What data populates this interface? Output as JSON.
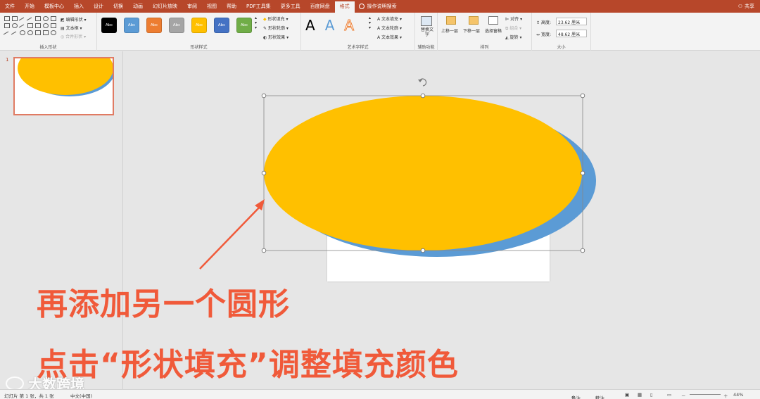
{
  "tabs": [
    "文件",
    "开始",
    "模板中心",
    "插入",
    "设计",
    "切换",
    "动画",
    "幻灯片放映",
    "审阅",
    "视图",
    "帮助",
    "PDF工具集",
    "更多工具",
    "百度网盘",
    "格式"
  ],
  "active_tab": "格式",
  "tell_me": "操作说明搜索",
  "share": "共享",
  "ribbon": {
    "insert_shapes": {
      "label": "插入形状",
      "edit_shape": "编辑形状",
      "text_box": "文本框",
      "merge_shapes": "合并形状"
    },
    "shape_styles": {
      "label": "形状样式",
      "swatches": [
        {
          "text": "Abc",
          "color": "#000000"
        },
        {
          "text": "Abc",
          "color": "#5b9bd5"
        },
        {
          "text": "Abc",
          "color": "#ed7d31"
        },
        {
          "text": "Abc",
          "color": "#a5a5a5"
        },
        {
          "text": "Abc",
          "color": "#ffc000"
        },
        {
          "text": "Abc",
          "color": "#4472c4"
        },
        {
          "text": "Abc",
          "color": "#70ad47"
        }
      ],
      "fill": "形状填充",
      "outline": "形状轮廓",
      "effects": "形状效果"
    },
    "wordart": {
      "label": "艺术字样式",
      "letters": [
        "A",
        "A",
        "A"
      ],
      "text_fill": "文本填充",
      "text_outline": "文本轮廓",
      "text_effects": "文本效果"
    },
    "accessibility": {
      "label": "辅助功能",
      "alt_text": "替换文字"
    },
    "arrange": {
      "label": "排列",
      "bring_forward": "上移一层",
      "send_backward": "下移一层",
      "selection_pane": "选择窗格",
      "align": "对齐",
      "group": "组合",
      "rotate": "旋转"
    },
    "size": {
      "label": "大小",
      "height_label": "高度:",
      "height": "23.62 厘米",
      "width_label": "宽度:",
      "width": "48.62 厘米"
    }
  },
  "slide_panel": {
    "number": "1"
  },
  "annotations": {
    "line1": "再添加另一个圆形",
    "line2": "点击“形状填充”调整填充颜色"
  },
  "watermark": "大数跨境",
  "status": {
    "slide_info": "幻灯片 第 1 张，共 1 张",
    "language": "中文(中国)",
    "notes": "备注",
    "comments": "批注",
    "zoom": "44%"
  },
  "colors": {
    "accent": "#b7472a",
    "yellow": "#ffc000",
    "blue": "#5b9bd5",
    "annotation": "#f05a3a"
  }
}
